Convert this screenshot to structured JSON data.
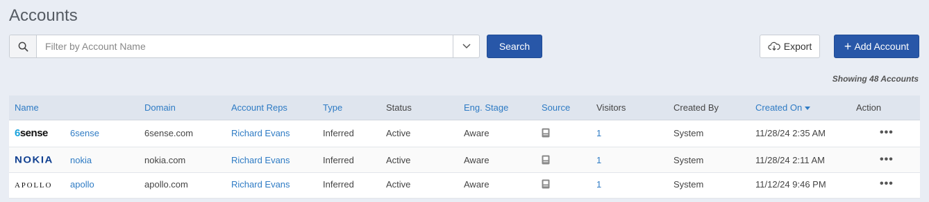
{
  "page": {
    "title": "Accounts"
  },
  "search": {
    "placeholder": "Filter by Account Name",
    "value": "",
    "button_label": "Search"
  },
  "toolbar": {
    "export_label": "Export",
    "add_label": "Add Account"
  },
  "summary": {
    "showing_text": "Showing 48 Accounts"
  },
  "table": {
    "columns": [
      {
        "label": "Name",
        "sortable": true
      },
      {
        "label": "Domain",
        "sortable": true
      },
      {
        "label": "Account Reps",
        "sortable": true
      },
      {
        "label": "Type",
        "sortable": true
      },
      {
        "label": "Status",
        "sortable": false
      },
      {
        "label": "Eng. Stage",
        "sortable": true
      },
      {
        "label": "Source",
        "sortable": true
      },
      {
        "label": "Visitors",
        "sortable": false
      },
      {
        "label": "Created By",
        "sortable": false
      },
      {
        "label": "Created On",
        "sortable": true,
        "sorted": "desc"
      },
      {
        "label": "Action",
        "sortable": false
      }
    ],
    "rows": [
      {
        "logo": "6sense",
        "name": "6sense",
        "domain": "6sense.com",
        "rep": "Richard Evans",
        "type": "Inferred",
        "status": "Active",
        "stage": "Aware",
        "source_icon": "document-icon",
        "visitors": "1",
        "created_by": "System",
        "created_on": "11/28/24 2:35 AM",
        "action": "•••"
      },
      {
        "logo": "NOKIA",
        "name": "nokia",
        "domain": "nokia.com",
        "rep": "Richard Evans",
        "type": "Inferred",
        "status": "Active",
        "stage": "Aware",
        "source_icon": "document-icon",
        "visitors": "1",
        "created_by": "System",
        "created_on": "11/28/24 2:11 AM",
        "action": "•••"
      },
      {
        "logo": "APOLLO",
        "name": "apollo",
        "domain": "apollo.com",
        "rep": "Richard Evans",
        "type": "Inferred",
        "status": "Active",
        "stage": "Aware",
        "source_icon": "document-icon",
        "visitors": "1",
        "created_by": "System",
        "created_on": "11/12/24 9:46 PM",
        "action": "•••"
      }
    ]
  },
  "colors": {
    "background": "#e9edf4",
    "primary": "#2857a8",
    "link": "#2e7bc4",
    "header_bg": "#dfe5ee"
  }
}
